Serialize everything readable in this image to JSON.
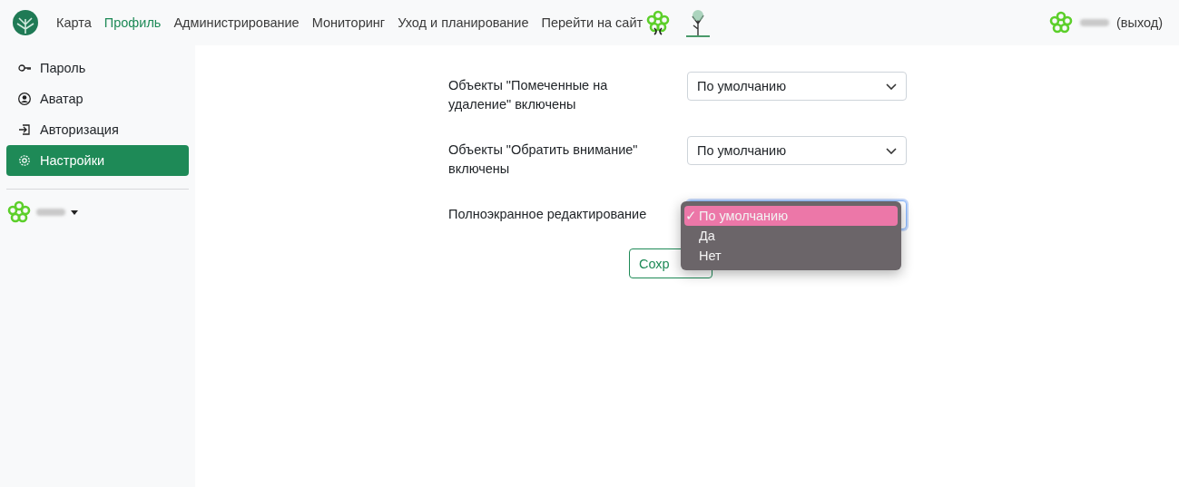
{
  "navbar": {
    "items": [
      {
        "label": "Карта",
        "selected": false
      },
      {
        "label": "Профиль",
        "selected": true
      },
      {
        "label": "Администрирование",
        "selected": false
      },
      {
        "label": "Мониторинг",
        "selected": false
      },
      {
        "label": "Уход и планирование",
        "selected": false
      },
      {
        "label": "Перейти на сайт",
        "selected": false
      }
    ],
    "logout": "(выход)"
  },
  "sidebar": {
    "items": [
      {
        "label": "Пароль",
        "selected": false
      },
      {
        "label": "Аватар",
        "selected": false
      },
      {
        "label": "Авторизация",
        "selected": false
      },
      {
        "label": "Настройки",
        "selected": true
      }
    ]
  },
  "form": {
    "fields": [
      {
        "label": "Объекты \"Помеченные на удаление\" включены",
        "value": "По умолчанию",
        "focused": false
      },
      {
        "label": "Объекты \"Обратить внимание\" включены",
        "value": "По умолчанию",
        "focused": false
      },
      {
        "label": "Полноэкранное редактирование",
        "focused": true
      }
    ],
    "save_button": "Сохр"
  },
  "dropdown": {
    "check": "✓",
    "options": [
      {
        "label": "По умолчанию",
        "selected": true
      },
      {
        "label": "Да",
        "selected": false
      },
      {
        "label": "Нет",
        "selected": false
      }
    ]
  }
}
